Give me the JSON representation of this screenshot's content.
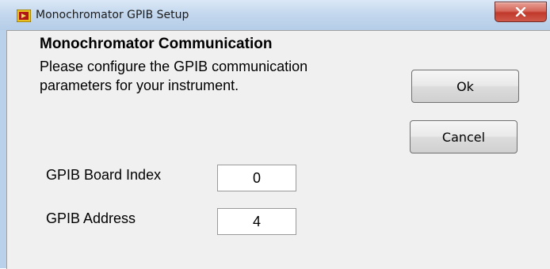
{
  "window": {
    "title": "Monochromator GPIB Setup"
  },
  "content": {
    "heading": "Monochromator Communication",
    "description_line1": "Please configure the GPIB communication",
    "description_line2": "parameters for your instrument."
  },
  "buttons": {
    "ok_label": "Ok",
    "cancel_label": "Cancel"
  },
  "fields": {
    "board_index": {
      "label": "GPIB Board Index",
      "value": "0"
    },
    "address": {
      "label": "GPIB Address",
      "value": "4"
    }
  },
  "icons": {
    "app": "labview-app-icon",
    "close": "close-icon"
  },
  "colors": {
    "titlebar": "#c4d8ee",
    "close_button": "#c0392b",
    "dialog_bg": "#f0f0f0"
  }
}
